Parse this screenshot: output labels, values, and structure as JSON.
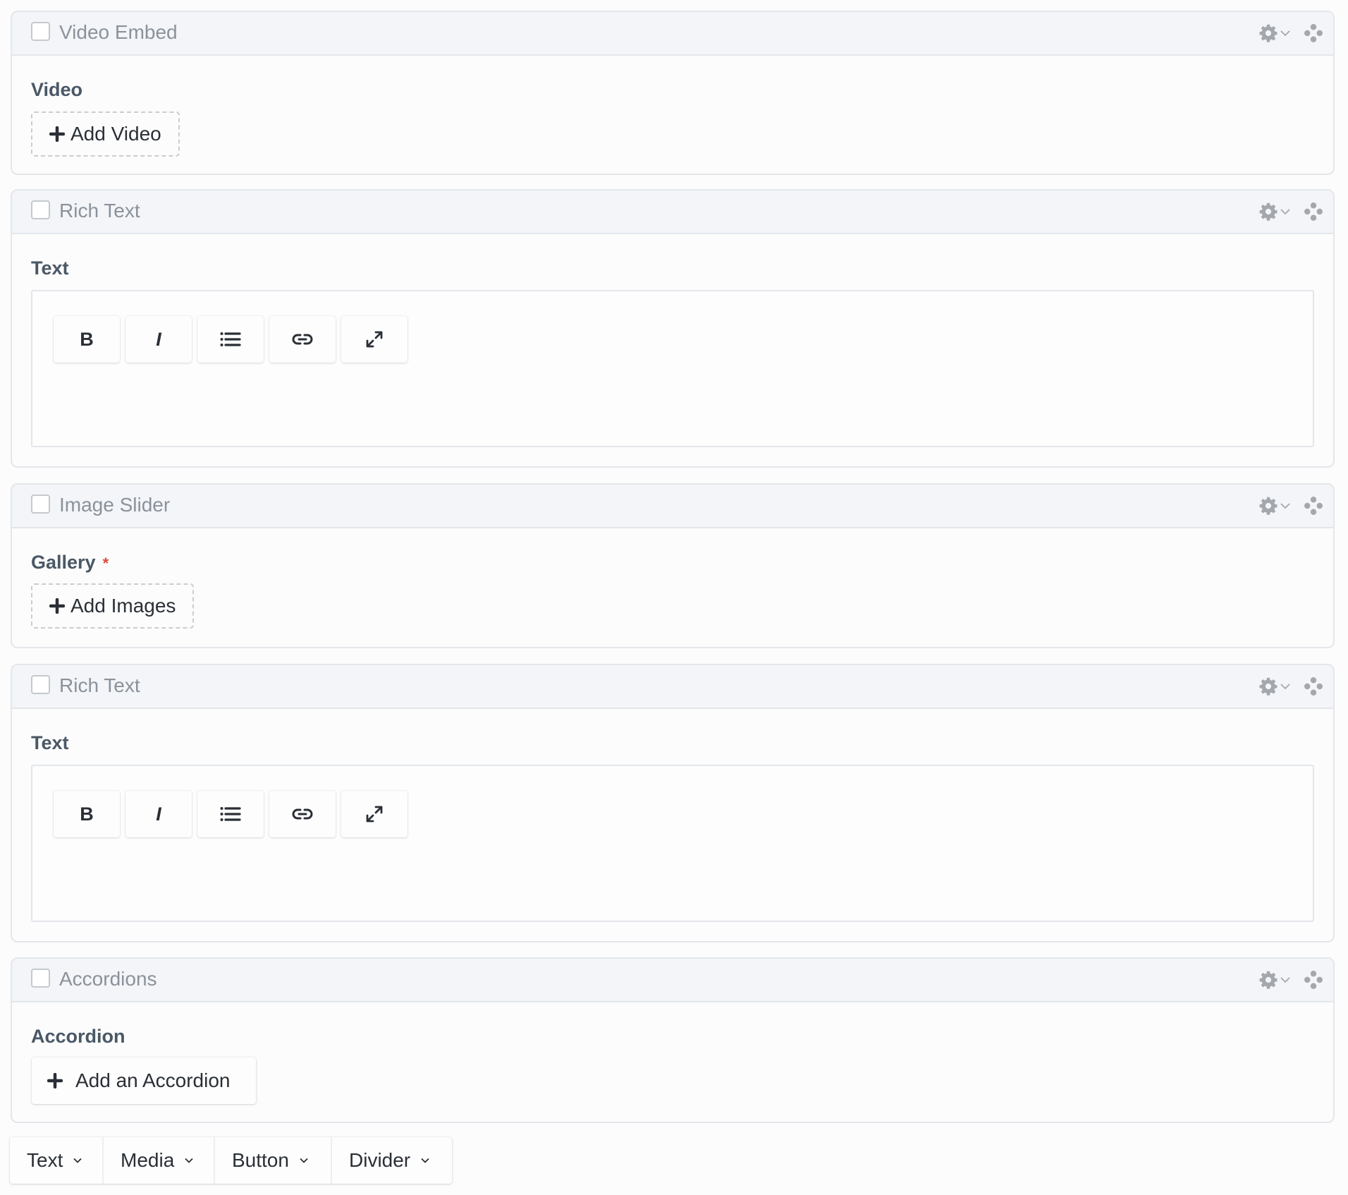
{
  "blocks": [
    {
      "type_title": "Video Embed",
      "field_label": "Video",
      "required": false,
      "kind": "dashed-button",
      "button_label": "Add Video",
      "icons": {
        "settings": "gear-icon",
        "menu": "chevron-down-icon",
        "drag": "drag-handle-icon"
      }
    },
    {
      "type_title": "Rich Text",
      "field_label": "Text",
      "required": false,
      "kind": "editor",
      "toolbar": [
        {
          "label": "B",
          "icon": "bold-icon"
        },
        {
          "label": "I",
          "icon": "italic-icon"
        },
        {
          "label": "",
          "icon": "list-icon"
        },
        {
          "label": "",
          "icon": "link-icon"
        },
        {
          "label": "",
          "icon": "fullscreen-icon"
        }
      ],
      "value": ""
    },
    {
      "type_title": "Image Slider",
      "field_label": "Gallery",
      "required": true,
      "required_marker": "*",
      "kind": "dashed-button",
      "button_label": "Add Images"
    },
    {
      "type_title": "Rich Text",
      "field_label": "Text",
      "required": false,
      "kind": "editor",
      "toolbar": [
        {
          "label": "B",
          "icon": "bold-icon"
        },
        {
          "label": "I",
          "icon": "italic-icon"
        },
        {
          "label": "",
          "icon": "list-icon"
        },
        {
          "label": "",
          "icon": "link-icon"
        },
        {
          "label": "",
          "icon": "fullscreen-icon"
        }
      ],
      "value": ""
    },
    {
      "type_title": "Accordions",
      "field_label": "Accordion",
      "required": false,
      "kind": "solid-button",
      "button_label": "Add an Accordion"
    }
  ],
  "add_block_bar": [
    {
      "label": "Text"
    },
    {
      "label": "Media"
    },
    {
      "label": "Button"
    },
    {
      "label": "Divider"
    }
  ],
  "colors": {
    "header_bg": "#f3f5f8",
    "border": "#e3e6ea",
    "title_text": "#8b929b",
    "label_text": "#4a5866",
    "required": "#e0473a",
    "icon_gray": "#a4a8ad"
  }
}
